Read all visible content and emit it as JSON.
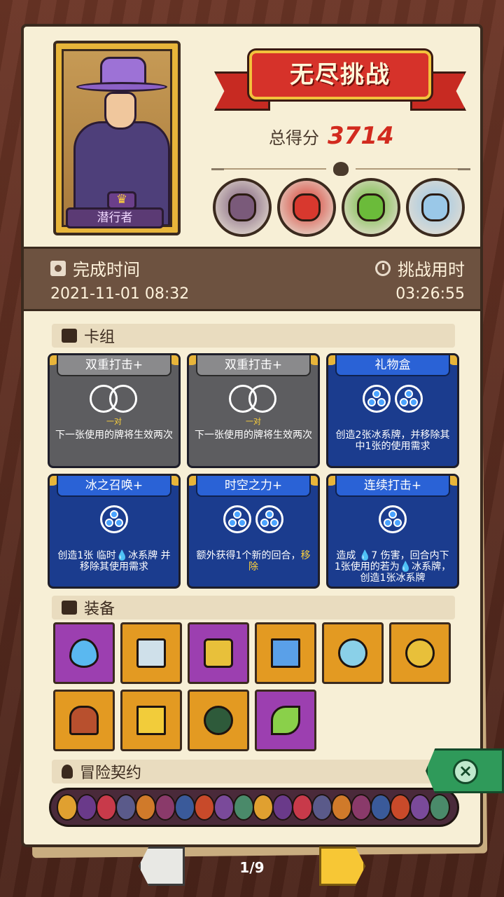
{
  "header": {
    "character_name": "潜行者",
    "title": "无尽挑战",
    "score_label": "总得分",
    "score_value": "3714"
  },
  "bosses": [
    {
      "name": "stone-golem-boss",
      "color": "#7a5a7a"
    },
    {
      "name": "red-demon-boss",
      "color": "#d8382e"
    },
    {
      "name": "goblin-king-boss",
      "color": "#6bbb3a"
    },
    {
      "name": "winged-beast-boss",
      "color": "#9ac8e8"
    }
  ],
  "time": {
    "finish_label": "完成时间",
    "finish_value": "2021-11-01 08:32",
    "duration_label": "挑战用时",
    "duration_value": "03:26:55"
  },
  "deck": {
    "section_title": "卡组",
    "cards": [
      {
        "name": "双重打击+",
        "style": "gray",
        "icon": "double-ring-icon",
        "sub": "一对",
        "desc": "下一张使用的牌将生效两次"
      },
      {
        "name": "双重打击+",
        "style": "gray",
        "icon": "double-ring-icon",
        "sub": "一对",
        "desc": "下一张使用的牌将生效两次"
      },
      {
        "name": "礼物盒",
        "style": "blue",
        "icon": "ice-orb-icon-x2",
        "sub": "",
        "desc": "创造2张冰系牌，并移除其中1张的使用需求"
      },
      {
        "name": "冰之召唤+",
        "style": "blue",
        "icon": "ice-orb-icon",
        "sub": "",
        "desc": "创造1张 临时💧冰系牌 并移除其使用需求"
      },
      {
        "name": "时空之力+",
        "style": "blue",
        "icon": "ice-orb-icon-x2",
        "sub": "",
        "desc": "额外获得1个新的回合，",
        "desc_hl": "移除"
      },
      {
        "name": "连续打击+",
        "style": "blue",
        "icon": "ice-orb-icon",
        "sub": "",
        "desc": "造成 💧7 伤害，回合内下1张使用的若为💧冰系牌，创造1张冰系牌"
      }
    ]
  },
  "equipment": {
    "section_title": "装备",
    "items": [
      {
        "icon": "water-drop-icon",
        "color": "#9c3fb0"
      },
      {
        "icon": "serrated-blade-icon",
        "color": "#e39a22"
      },
      {
        "icon": "rune-tile-icon",
        "color": "#9c3fb0"
      },
      {
        "icon": "blue-crystal-icon",
        "color": "#e39a22"
      },
      {
        "icon": "ghost-slime-icon",
        "color": "#e39a22"
      },
      {
        "icon": "golden-amulet-icon",
        "color": "#e39a22"
      },
      {
        "icon": "red-hood-icon",
        "color": "#e39a22"
      },
      {
        "icon": "golden-crown-icon",
        "color": "#e39a22"
      },
      {
        "icon": "thorn-ring-icon",
        "color": "#e39a22"
      },
      {
        "icon": "green-leaf-icon",
        "color": "#9c3fb0"
      }
    ]
  },
  "contracts": {
    "section_title": "冒险契约",
    "count": 20
  },
  "pagination": {
    "page": "1/9"
  }
}
